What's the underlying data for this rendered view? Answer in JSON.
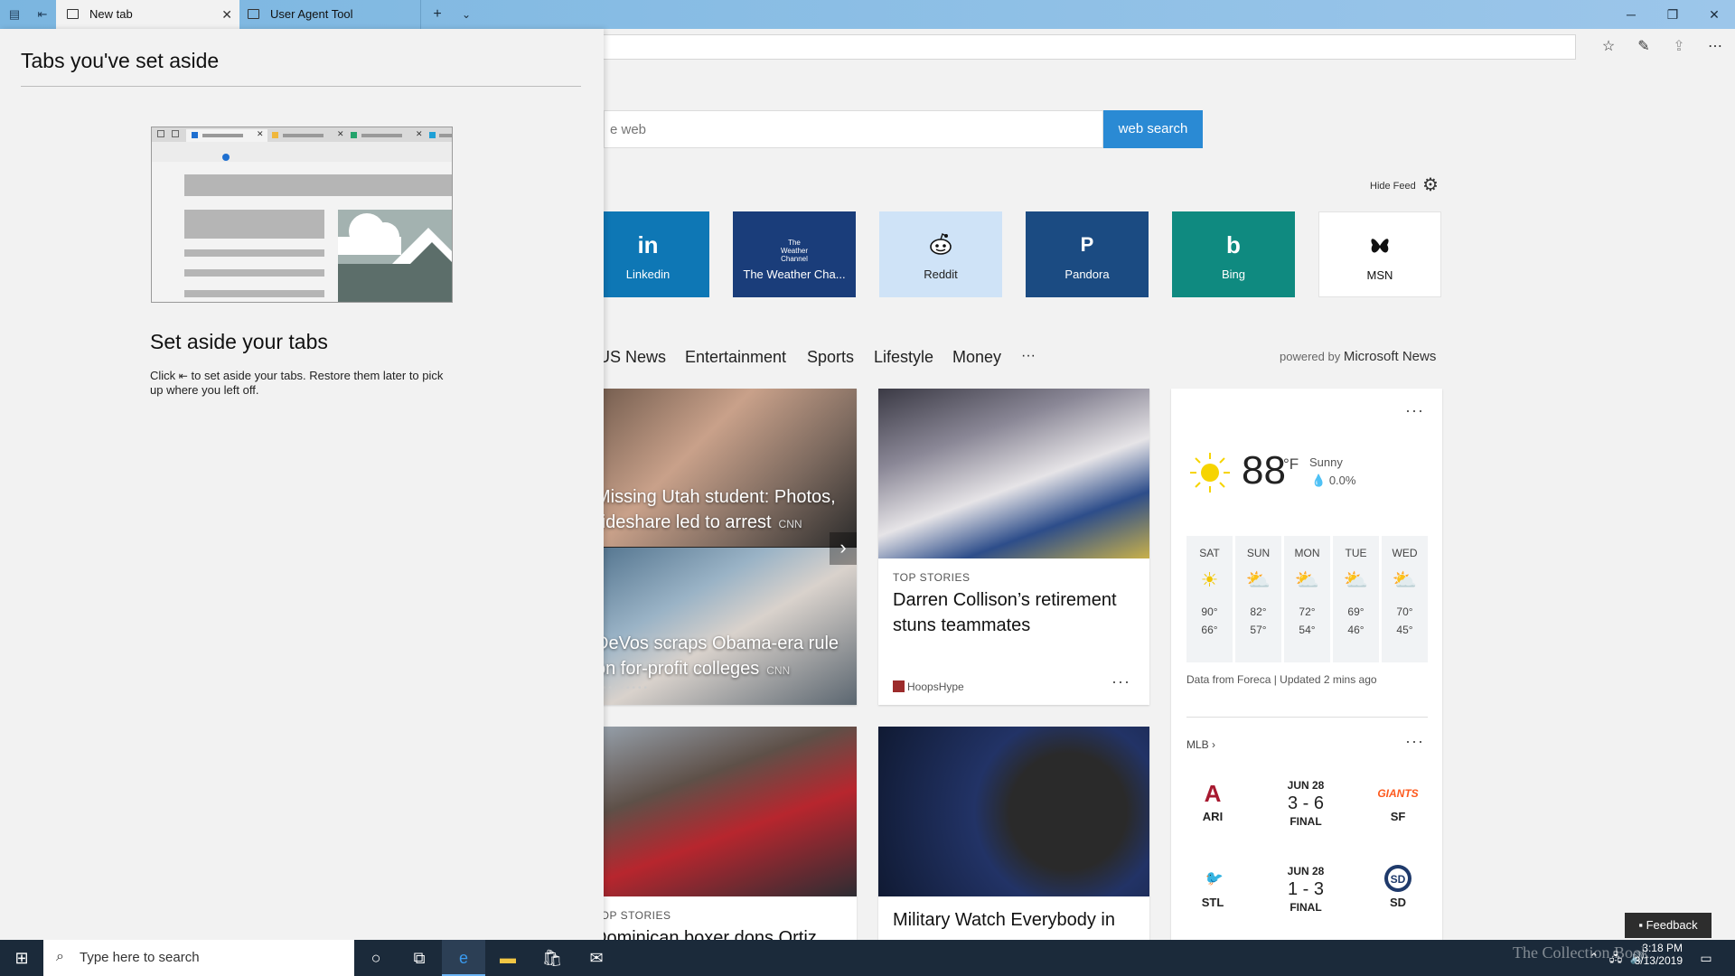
{
  "browser": {
    "tabs": [
      {
        "label": "New tab",
        "active": true
      },
      {
        "label": "User Agent Tool",
        "active": false
      }
    ]
  },
  "search": {
    "placeholder": "e web",
    "button": "web search"
  },
  "feed": {
    "hide_label": "Hide Feed"
  },
  "tiles": [
    {
      "label": "Linkedin",
      "logo": "in",
      "color": "#0e77b5"
    },
    {
      "label": "The Weather Cha...",
      "logo": "The Weather Channel",
      "color": "#1a3d7a"
    },
    {
      "label": "Reddit",
      "logo": "reddit-alien",
      "color": "#cfe3f7"
    },
    {
      "label": "Pandora",
      "logo": "P",
      "color": "#1b4b82"
    },
    {
      "label": "Bing",
      "logo": "b",
      "color": "#0f8a80"
    },
    {
      "label": "MSN",
      "logo": "butterfly",
      "color": "#ffffff"
    }
  ],
  "categories": [
    "US News",
    "Entertainment",
    "Sports",
    "Lifestyle",
    "Money",
    "···"
  ],
  "powered": {
    "prefix": "powered by",
    "brand": "Microsoft News"
  },
  "stories": {
    "carousel": [
      {
        "title": "Missing Utah student: Photos, rideshare led to arrest",
        "source": "CNN"
      },
      {
        "title": "DeVos scraps Obama-era rule on for-profit colleges",
        "source": "CNN"
      }
    ],
    "card1": {
      "kicker": "TOP STORIES",
      "title": "Darren Collison’s retirement stuns teammates",
      "source": "HoopsHype"
    },
    "card2": {
      "kicker": "TOP STORIES",
      "title": "Dominican boxer dons Ortiz"
    },
    "card3": {
      "title": "Military Watch Everybody in"
    }
  },
  "weather": {
    "temp": "88",
    "unit": "°F",
    "condition": "Sunny",
    "precip": "0.0%",
    "forecast": [
      {
        "day": "SAT",
        "hi": "90°",
        "lo": "66°",
        "icon": "sun-icon"
      },
      {
        "day": "SUN",
        "hi": "82°",
        "lo": "57°",
        "icon": "partly-cloudy-icon"
      },
      {
        "day": "MON",
        "hi": "72°",
        "lo": "54°",
        "icon": "partly-cloudy-icon"
      },
      {
        "day": "TUE",
        "hi": "69°",
        "lo": "46°",
        "icon": "partly-cloudy-icon"
      },
      {
        "day": "WED",
        "hi": "70°",
        "lo": "45°",
        "icon": "partly-cloudy-icon"
      }
    ],
    "footer": "Data from Foreca | Updated 2 mins ago"
  },
  "mlb": {
    "label": "MLB",
    "games": [
      {
        "date": "JUN 28",
        "score": "3 - 6",
        "status": "FINAL",
        "away": "ARI",
        "home": "SF"
      },
      {
        "date": "JUN 28",
        "score": "1 - 3",
        "status": "FINAL",
        "away": "STL",
        "home": "SD"
      }
    ]
  },
  "set_aside": {
    "title": "Tabs you've set aside",
    "heading": "Set aside your tabs",
    "body_before": "Click",
    "body_after": "to set aside your tabs. Restore them later to pick up where you left off."
  },
  "feedback": "Feedback",
  "taskbar": {
    "search_placeholder": "Type here to search",
    "time": "3:18 PM",
    "date": "3/13/2019"
  },
  "watermark": "The Collection Book"
}
